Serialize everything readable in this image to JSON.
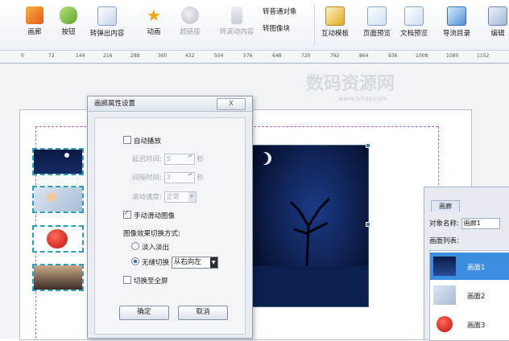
{
  "toolbar": {
    "items": [
      {
        "label": "画廊"
      },
      {
        "label": "按钮"
      },
      {
        "label": "转弹出内容"
      },
      {
        "label": "动画"
      },
      {
        "label": "超链接"
      },
      {
        "label": "转滚动内容"
      },
      {
        "label": "转普通对象"
      },
      {
        "label": "转图像块"
      },
      {
        "label": "互动模板"
      },
      {
        "label": "页面预览"
      },
      {
        "label": "文档预览"
      },
      {
        "label": "导流目录"
      },
      {
        "label": "编辑"
      }
    ]
  },
  "ruler": {
    "ticks": [
      "0",
      "72",
      "144",
      "216",
      "288",
      "360",
      "432",
      "504",
      "576",
      "648",
      "720",
      "792",
      "864",
      "936",
      "1008",
      "1080",
      "1152"
    ]
  },
  "watermark": {
    "title": "数码资源网",
    "url": "www.smzy.com"
  },
  "dialog": {
    "title": "画廊属性设置",
    "close": "X",
    "autoplay": "自动播放",
    "delay_label": "延迟时间:",
    "delay_value": "5",
    "interval_label": "间隔时间:",
    "interval_value": "3",
    "unit": "秒",
    "speed_label": "滚动速度:",
    "speed_value": "正常",
    "manual": "手动滑动图像",
    "effect_label": "图像效果切换方式:",
    "fade": "淡入淡出",
    "seamless": "无缝切换",
    "direction": "从右向左",
    "fullscreen": "切换至全屏",
    "ok": "确定",
    "cancel": "取消"
  },
  "panel": {
    "tab": "画廊",
    "name_label": "对象名称:",
    "name_value": "画廊1",
    "list_label": "画面列表:",
    "items": [
      {
        "label": "画面1"
      },
      {
        "label": "画面2"
      },
      {
        "label": "画面3"
      }
    ]
  },
  "colors": {
    "accent": "#3b8de0",
    "selection_border": "#26a0c0",
    "guide": "#c560c5",
    "night_sky": "#0b1a3d"
  }
}
